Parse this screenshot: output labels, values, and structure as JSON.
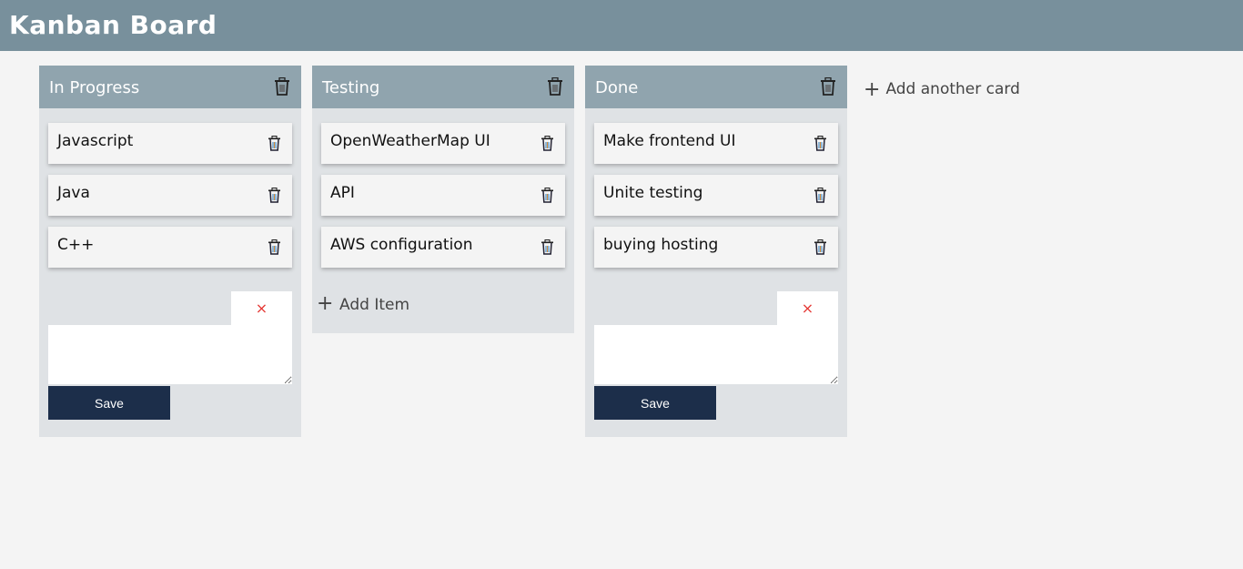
{
  "header": {
    "title": "Kanban Board"
  },
  "columns": [
    {
      "title": "In Progress",
      "cards": [
        "Javascript",
        "Java",
        "C++"
      ],
      "form_open": true,
      "close_label": "×",
      "save_label": "Save"
    },
    {
      "title": "Testing",
      "cards": [
        "OpenWeatherMap UI",
        "API",
        "AWS configuration"
      ],
      "form_open": false,
      "add_item_label": "Add Item"
    },
    {
      "title": "Done",
      "cards": [
        "Make frontend UI",
        "Unite testing",
        "buying hosting"
      ],
      "form_open": true,
      "close_label": "×",
      "save_label": "Save"
    }
  ],
  "add_card_label": "Add another card",
  "colors": {
    "header": "#78909c",
    "column_header": "#90a4ae",
    "save_button": "#1c2e4a",
    "close": "#e53935"
  }
}
